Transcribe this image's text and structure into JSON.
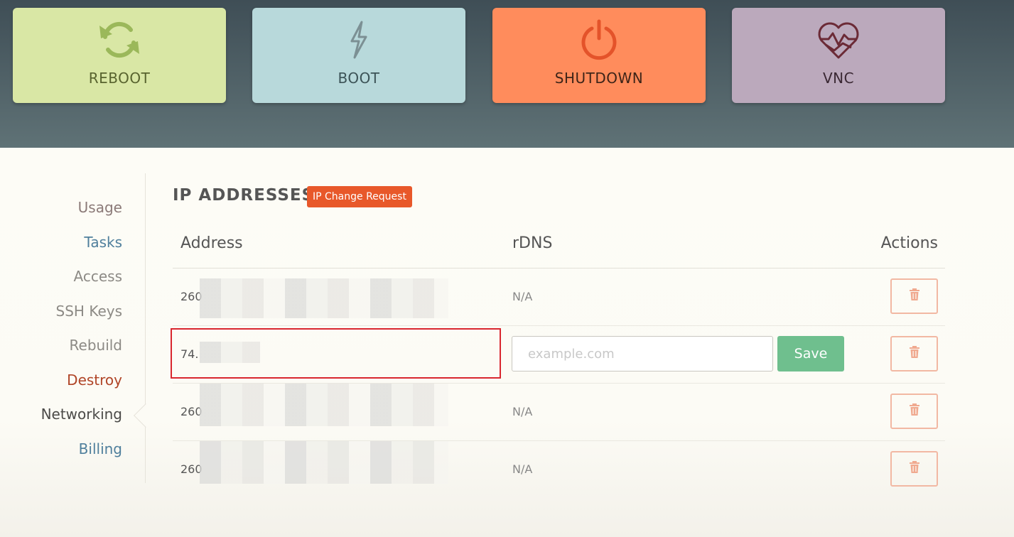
{
  "actions": {
    "reboot": {
      "label": "REBOOT",
      "icon": "refresh-icon"
    },
    "boot": {
      "label": "BOOT",
      "icon": "lightning-icon"
    },
    "shutdown": {
      "label": "SHUTDOWN",
      "icon": "power-icon"
    },
    "vnc": {
      "label": "VNC",
      "icon": "heart-monitor-icon"
    }
  },
  "sidebar": {
    "items": [
      {
        "label": "Usage"
      },
      {
        "label": "Tasks"
      },
      {
        "label": "Access"
      },
      {
        "label": "SSH Keys"
      },
      {
        "label": "Rebuild"
      },
      {
        "label": "Destroy"
      },
      {
        "label": "Networking"
      },
      {
        "label": "Billing"
      }
    ],
    "active": "Networking"
  },
  "section": {
    "title": "IP ADDRESSES",
    "change_request_label": "IP Change Request"
  },
  "table": {
    "headers": {
      "address": "Address",
      "rdns": "rDNS",
      "actions": "Actions"
    },
    "rows": [
      {
        "address": "260",
        "rdns": "N/A"
      },
      {
        "address": "74.",
        "rdns_placeholder": "example.com",
        "save_label": "Save"
      },
      {
        "address": "260",
        "rdns": "N/A"
      },
      {
        "address": "260",
        "rdns": "N/A"
      }
    ]
  },
  "colors": {
    "reboot": "#d9e7a5",
    "boot": "#b8d9db",
    "shutdown": "#ff8c5c",
    "vnc": "#bba9bc",
    "accent_orange": "#e8582a",
    "save_green": "#6fbf8e",
    "highlight_red": "#d9262f"
  }
}
